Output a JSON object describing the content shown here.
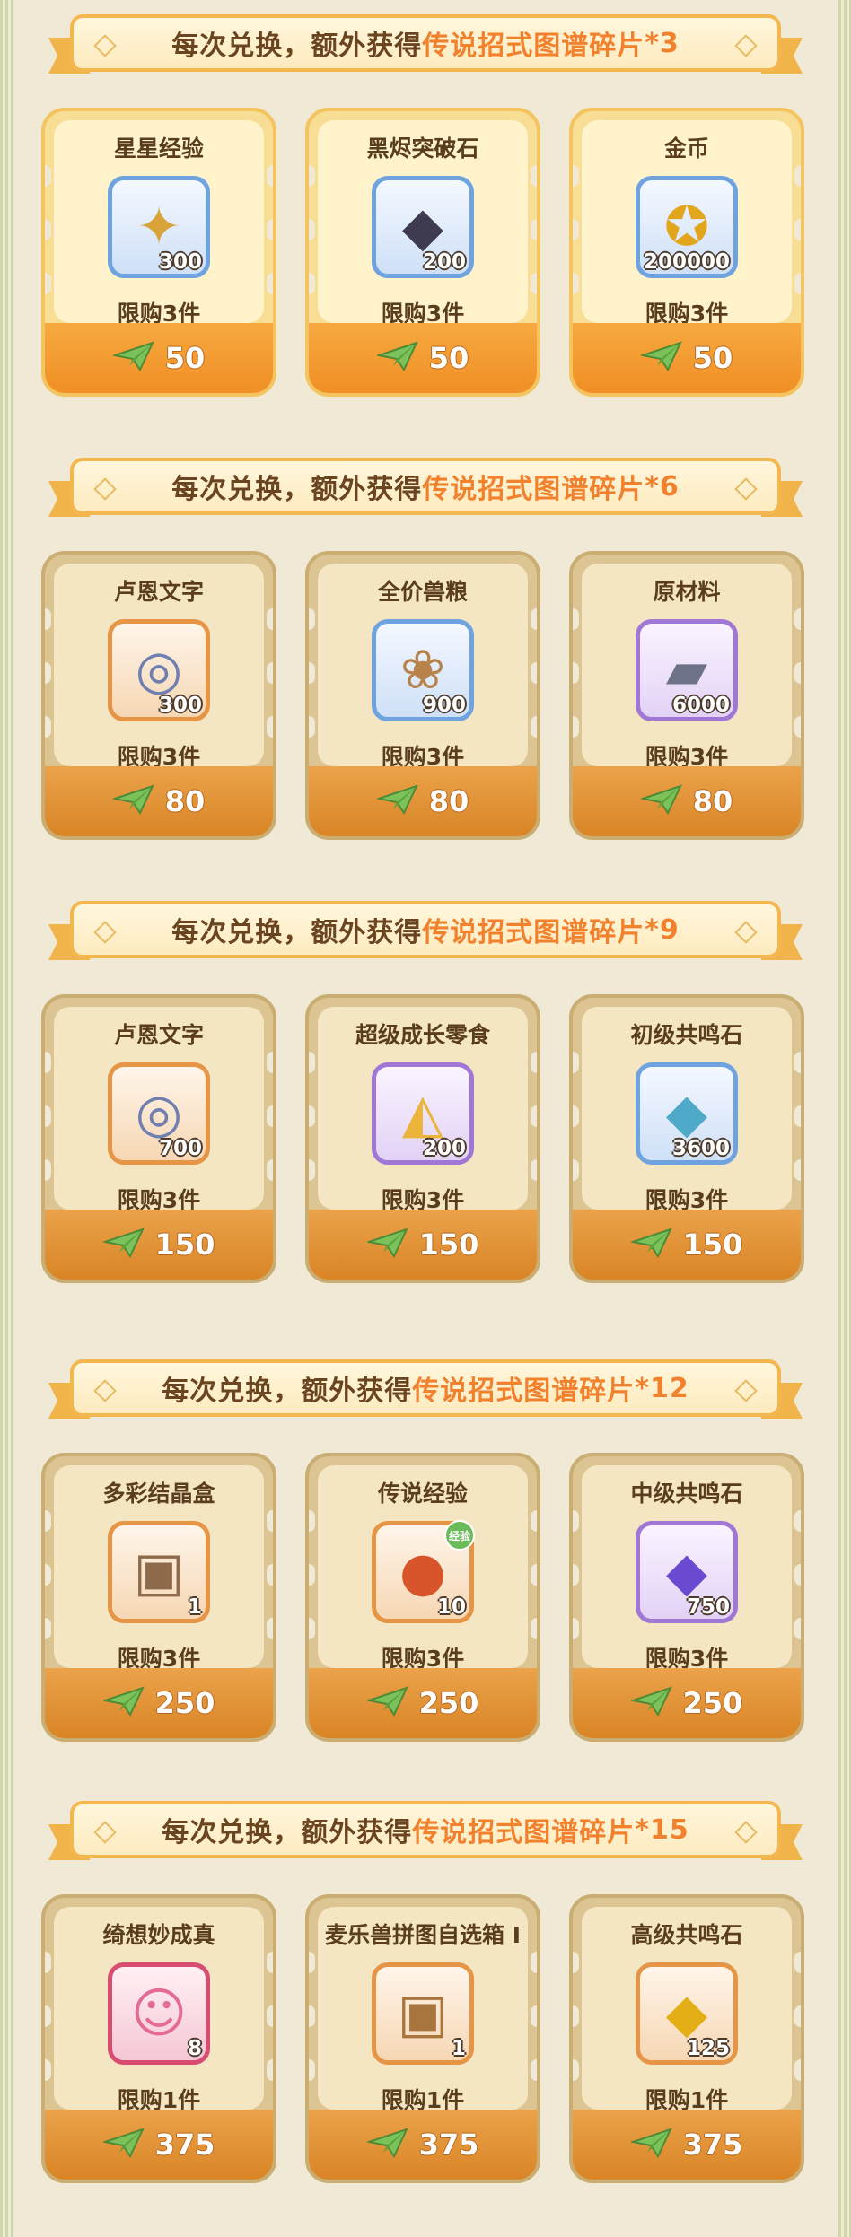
{
  "banner_prefix": "每次兑换，额外获得",
  "banner_highlight": "传说招式图谱碎片",
  "tiers": [
    {
      "bonus": "*3",
      "theme": "gold",
      "items": [
        {
          "name": "星星经验",
          "qty": "300",
          "limit": "限购3件",
          "price": "50",
          "icon": "star-card-icon",
          "glyph": "✦",
          "rarity": "blue"
        },
        {
          "name": "黑烬突破石",
          "qty": "200",
          "limit": "限购3件",
          "price": "50",
          "icon": "ember-stone-icon",
          "glyph": "◆",
          "rarity": "blue"
        },
        {
          "name": "金币",
          "qty": "200000",
          "limit": "限购3件",
          "price": "50",
          "icon": "gold-coin-icon",
          "glyph": "✪",
          "rarity": "blue"
        }
      ]
    },
    {
      "bonus": "*6",
      "theme": "tan",
      "items": [
        {
          "name": "卢恩文字",
          "qty": "300",
          "limit": "限购3件",
          "price": "80",
          "icon": "rune-orb-icon",
          "glyph": "◎",
          "rarity": "orange"
        },
        {
          "name": "全价兽粮",
          "qty": "900",
          "limit": "限购3件",
          "price": "80",
          "icon": "pet-food-bag-icon",
          "glyph": "❀",
          "rarity": "blue"
        },
        {
          "name": "原材料",
          "qty": "6000",
          "limit": "限购3件",
          "price": "80",
          "icon": "metal-ingot-icon",
          "glyph": "▰",
          "rarity": "purple"
        }
      ]
    },
    {
      "bonus": "*9",
      "theme": "tan",
      "items": [
        {
          "name": "卢恩文字",
          "qty": "700",
          "limit": "限购3件",
          "price": "150",
          "icon": "rune-orb-icon",
          "glyph": "◎",
          "rarity": "orange"
        },
        {
          "name": "超级成长零食",
          "qty": "200",
          "limit": "限购3件",
          "price": "150",
          "icon": "cheese-icon",
          "glyph": "◭",
          "rarity": "purple"
        },
        {
          "name": "初级共鸣石",
          "qty": "3600",
          "limit": "限购3件",
          "price": "150",
          "icon": "blue-crystal-icon",
          "glyph": "◆",
          "rarity": "blue"
        }
      ]
    },
    {
      "bonus": "*12",
      "theme": "tan",
      "items": [
        {
          "name": "多彩结晶盒",
          "qty": "1",
          "limit": "限购3件",
          "price": "250",
          "icon": "treasure-chest-icon",
          "glyph": "▣",
          "rarity": "orange"
        },
        {
          "name": "传说经验",
          "qty": "10",
          "limit": "限购3件",
          "price": "250",
          "icon": "legend-exp-icon",
          "glyph": "●",
          "rarity": "orange",
          "badge": "经验"
        },
        {
          "name": "中级共鸣石",
          "qty": "750",
          "limit": "限购3件",
          "price": "250",
          "icon": "purple-crystal-icon",
          "glyph": "◆",
          "rarity": "purple"
        }
      ]
    },
    {
      "bonus": "*15",
      "theme": "tan",
      "items": [
        {
          "name": "绮想妙成真",
          "qty": "8",
          "limit": "限购1件",
          "price": "375",
          "icon": "pink-cat-icon",
          "glyph": "☺",
          "rarity": "red"
        },
        {
          "name": "麦乐兽拼图自选箱 I",
          "qty": "1",
          "limit": "限购1件",
          "price": "375",
          "icon": "puzzle-box-icon",
          "glyph": "▣",
          "rarity": "orange"
        },
        {
          "name": "高级共鸣石",
          "qty": "125",
          "limit": "限购1件",
          "price": "375",
          "icon": "gold-crystal-icon",
          "glyph": "◆",
          "rarity": "orange"
        }
      ]
    }
  ],
  "currency_icon": "paper-plane-icon",
  "colors": {
    "highlight": "#f2812e",
    "price_bar_gold": "#f08f25",
    "price_bar_tan": "#d98526",
    "card_gold": "#f8dd94",
    "card_tan": "#dcc593",
    "background": "#efe9d6"
  }
}
